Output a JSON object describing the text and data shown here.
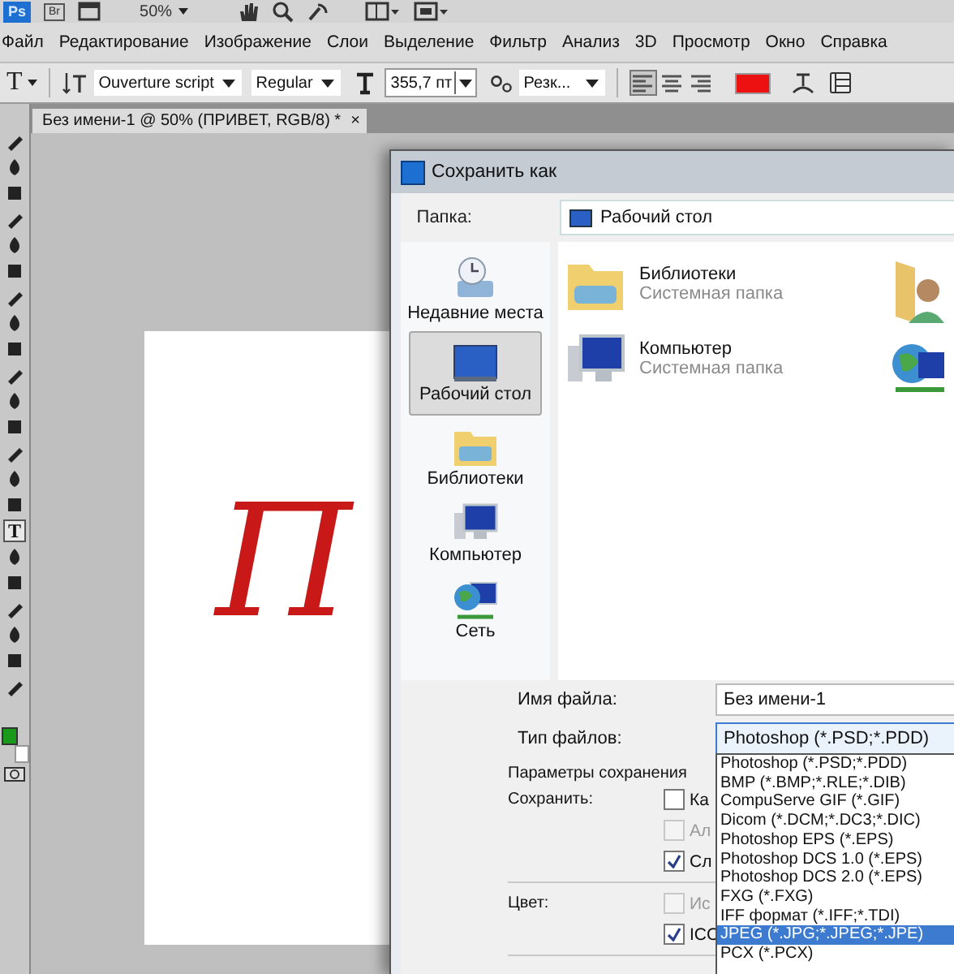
{
  "app_bar": {
    "logo": "Ps",
    "bridge": "Br",
    "zoom": "50%"
  },
  "menu": [
    "Файл",
    "Редактирование",
    "Изображение",
    "Слои",
    "Выделение",
    "Фильтр",
    "Анализ",
    "3D",
    "Просмотр",
    "Окно",
    "Справка"
  ],
  "options_bar": {
    "tool": "T",
    "font": "Ouverture script",
    "style": "Regular",
    "size": "355,7 пт",
    "antialias": "Резк...",
    "align": [
      {
        "selected": true
      },
      {
        "selected": false
      },
      {
        "selected": false
      }
    ]
  },
  "tools": [
    {
      "kind": "glyph",
      "selected": false
    },
    {
      "kind": "glyph",
      "selected": false
    },
    {
      "kind": "glyph",
      "selected": false
    },
    {
      "kind": "glyph",
      "selected": false
    },
    {
      "kind": "glyph",
      "selected": false
    },
    {
      "kind": "glyph",
      "selected": false
    },
    {
      "kind": "glyph",
      "selected": false
    },
    {
      "kind": "glyph",
      "selected": false
    },
    {
      "kind": "glyph",
      "selected": false
    },
    {
      "kind": "glyph",
      "selected": false
    },
    {
      "kind": "glyph",
      "selected": false
    },
    {
      "kind": "glyph",
      "selected": false
    },
    {
      "kind": "glyph",
      "selected": false
    },
    {
      "kind": "glyph",
      "selected": false
    },
    {
      "kind": "glyph",
      "selected": false
    },
    {
      "kind": "text",
      "label": "T",
      "selected": true
    },
    {
      "kind": "glyph",
      "selected": false
    },
    {
      "kind": "glyph",
      "selected": false
    },
    {
      "kind": "glyph",
      "selected": false
    },
    {
      "kind": "glyph",
      "selected": false
    },
    {
      "kind": "glyph",
      "selected": false
    },
    {
      "kind": "glyph",
      "selected": false
    }
  ],
  "document": {
    "tab": "Без имени-1 @ 50% (ПРИВЕТ, RGB/8) *",
    "close": "×",
    "canvas_text": "П"
  },
  "dialog": {
    "title": "Сохранить как",
    "folder_label": "Папка:",
    "folder": "Рабочий стол",
    "places": [
      {
        "kind": "recent",
        "label": "Недавние места",
        "selected": false
      },
      {
        "kind": "desktop",
        "label": "Рабочий стол",
        "selected": true
      },
      {
        "kind": "library",
        "label": "Библиотеки",
        "selected": false
      },
      {
        "kind": "computer",
        "label": "Компьютер",
        "selected": false
      },
      {
        "kind": "network",
        "label": "Сеть",
        "selected": false
      }
    ],
    "files": [
      {
        "kind": "library",
        "name": "Библиотеки",
        "type": "Системная папка"
      },
      {
        "kind": "computer",
        "name": "Компьютер",
        "type": "Системная папка"
      }
    ],
    "files_column_2": [
      {
        "kind": "user"
      },
      {
        "kind": "network"
      }
    ],
    "filename_label": "Имя файла:",
    "filename": "Без имени-1",
    "filetype_label": "Тип файлов:",
    "filetype": "Photoshop (*.PSD;*.PDD)",
    "options_title": "Параметры сохранения",
    "save_label": "Сохранить:",
    "save_options": [
      {
        "label": "Ка",
        "checked": false,
        "disabled": false
      },
      {
        "label": "Ал",
        "checked": false,
        "disabled": true
      },
      {
        "label": "Сл",
        "checked": true,
        "disabled": false
      }
    ],
    "color_label": "Цвет:",
    "color_options": [
      {
        "label": "Ис",
        "checked": false,
        "disabled": true
      },
      {
        "label": "ICC",
        "checked": true,
        "disabled": false
      }
    ],
    "filetype_options": [
      {
        "label": "Photoshop (*.PSD;*.PDD)",
        "selected": false
      },
      {
        "label": "BMP (*.BMP;*.RLE;*.DIB)",
        "selected": false
      },
      {
        "label": "CompuServe GIF (*.GIF)",
        "selected": false
      },
      {
        "label": "Dicom (*.DCM;*.DC3;*.DIC)",
        "selected": false
      },
      {
        "label": "Photoshop EPS (*.EPS)",
        "selected": false
      },
      {
        "label": "Photoshop DCS 1.0 (*.EPS)",
        "selected": false
      },
      {
        "label": "Photoshop DCS 2.0 (*.EPS)",
        "selected": false
      },
      {
        "label": "FXG (*.FXG)",
        "selected": false
      },
      {
        "label": "IFF формат (*.IFF;*.TDI)",
        "selected": false
      },
      {
        "label": "JPEG (*.JPG;*.JPEG;*.JPE)",
        "selected": true
      },
      {
        "label": "PCX (*.PCX)",
        "selected": false
      }
    ]
  }
}
